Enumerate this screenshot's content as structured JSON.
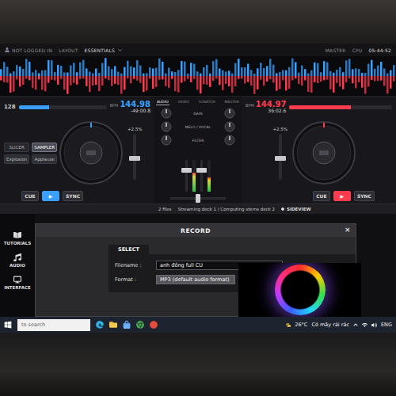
{
  "topbar": {
    "login": "NOT LOGGED IN",
    "layout_label": "LAYOUT",
    "layout": "ESSENTIALS",
    "master_label": "MASTER",
    "cpu_label": "CPU",
    "clock": "05:44:52"
  },
  "decks": [
    {
      "name": "deck-left",
      "color": "#3aa0ff",
      "header": "128",
      "bpm_label": "BPM",
      "bpm": "144.98",
      "time": "-49:00.8",
      "pitch_text": "+2.5%",
      "progress": 0.35,
      "pitch_level": 0.45,
      "pads": [
        {
          "label": "SLICER",
          "kind": "mode",
          "selected": false
        },
        {
          "label": "SAMPLER",
          "kind": "mode",
          "selected": true
        },
        {
          "label": "Explosion",
          "kind": "pad",
          "selected": false
        },
        {
          "label": "Applause",
          "kind": "pad",
          "selected": false
        }
      ],
      "buttons": [
        {
          "label": "CUE",
          "kind": "cue"
        },
        {
          "label": "▶",
          "kind": "play"
        },
        {
          "label": "SYNC",
          "kind": "sync"
        }
      ]
    },
    {
      "name": "deck-right",
      "color": "#ff3b4e",
      "header": "",
      "bpm_label": "BPM",
      "bpm": "144.97",
      "time": "36:02.6",
      "pitch_text": "+2.5%",
      "progress": 0.6,
      "pitch_level": 0.45,
      "pads": [],
      "buttons": [
        {
          "label": "CUE",
          "kind": "cue"
        },
        {
          "label": "▶",
          "kind": "play"
        },
        {
          "label": "SYNC",
          "kind": "sync"
        }
      ]
    }
  ],
  "mixer": {
    "tabs": [
      {
        "label": "AUDIO",
        "selected": true
      },
      {
        "label": "VIDEO",
        "selected": false
      },
      {
        "label": "SCRATCH",
        "selected": false
      },
      {
        "label": "MASTER",
        "selected": false
      }
    ],
    "knob_rows": [
      {
        "label": "GAIN",
        "levels": [
          0.5,
          0.5
        ]
      },
      {
        "label": "MELO / VOCAL",
        "levels": [
          0.5,
          0.5
        ]
      },
      {
        "label": "FILTER",
        "levels": [
          0.5,
          0.5
        ]
      }
    ],
    "channels": [
      {
        "level": 0.7,
        "meter": 0.6
      },
      {
        "level": 0.7,
        "meter": 0.45
      }
    ],
    "crossfader": 0.5
  },
  "browser": {
    "count": "2 files",
    "status": "Streaming deck 1 / Computing stems deck 2",
    "sideview": "SIDEVIEW"
  },
  "sidebar": {
    "items": [
      {
        "label": "TUTORIALS",
        "icon": "book"
      },
      {
        "label": "AUDIO",
        "icon": "audio"
      },
      {
        "label": "INTERFACE",
        "icon": "screen"
      }
    ]
  },
  "dialog": {
    "title": "RECORD",
    "close": "×",
    "tab": "SELECT",
    "fields": [
      {
        "label": "Filename :",
        "value": "anh đồng full CU",
        "kind": "text"
      },
      {
        "label": "Format :",
        "value": "MP3 (default audio format)",
        "kind": "select"
      }
    ]
  },
  "taskbar": {
    "search": "to search",
    "weather_temp": "26°C",
    "weather_text": "Có mây rải rác",
    "lang": "ENG"
  }
}
